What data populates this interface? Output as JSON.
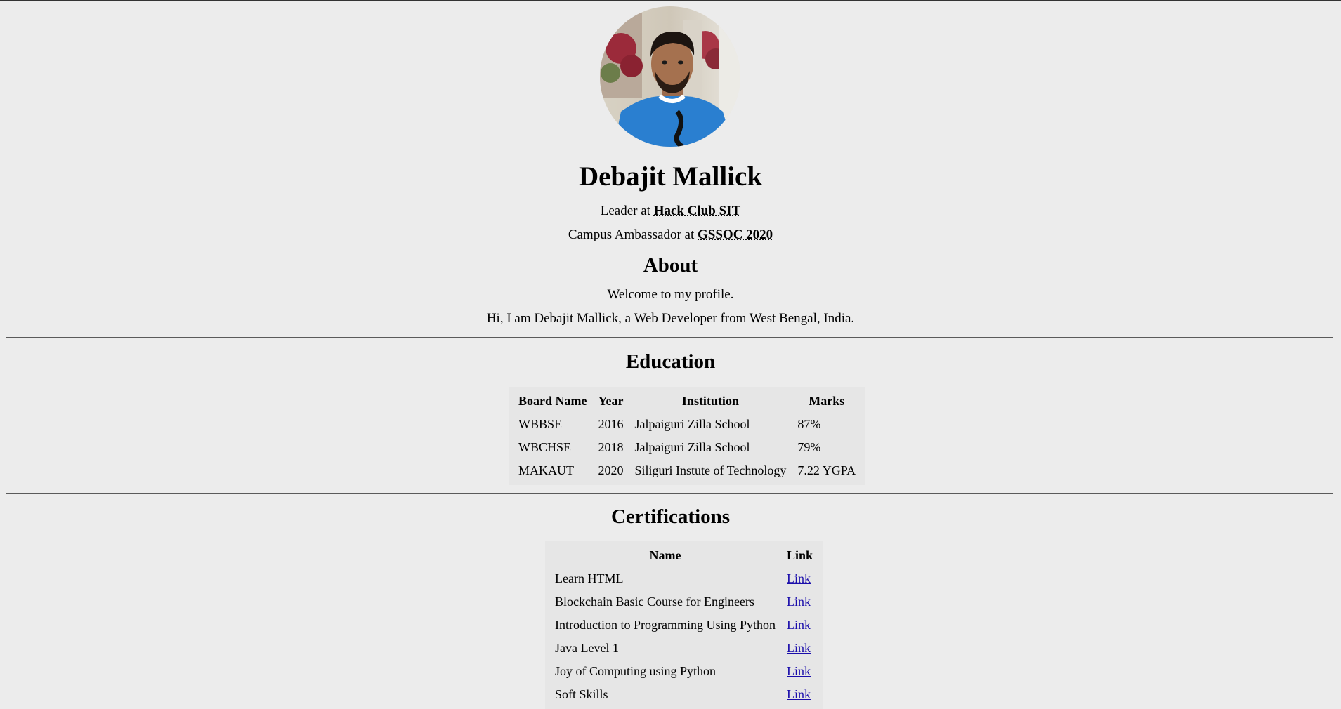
{
  "profile": {
    "name": "Debajit Mallick",
    "avatar_alt": "profile photo"
  },
  "roles": [
    {
      "prefix": "Leader at ",
      "org": "Hack Club SIT"
    },
    {
      "prefix": "Campus Ambassador at ",
      "org": "GSSOC 2020"
    }
  ],
  "about": {
    "title": "About",
    "line1": "Welcome to my profile.",
    "line2": "Hi, I am Debajit Mallick, a Web Developer from West Bengal, India."
  },
  "education": {
    "title": "Education",
    "headers": [
      "Board Name",
      "Year",
      "Institution",
      "Marks"
    ],
    "rows": [
      [
        "WBBSE",
        "2016",
        "Jalpaiguri Zilla School",
        "87%"
      ],
      [
        "WBCHSE",
        "2018",
        "Jalpaiguri Zilla School",
        "79%"
      ],
      [
        "MAKAUT",
        "2020",
        "Siliguri Instute of Technology",
        "7.22 YGPA"
      ]
    ]
  },
  "certifications": {
    "title": "Certifications",
    "headers": [
      "Name",
      "Link"
    ],
    "rows": [
      [
        "Learn HTML",
        "Link"
      ],
      [
        "Blockchain Basic Course for Engineers",
        "Link"
      ],
      [
        "Introduction to Programming Using Python",
        "Link"
      ],
      [
        "Java Level 1",
        "Link"
      ],
      [
        "Joy of Computing using Python",
        "Link"
      ],
      [
        "Soft Skills",
        "Link"
      ]
    ]
  },
  "colors": {
    "background": "#ececec",
    "table_bg": "#e6e6e6",
    "link": "#1a0dab",
    "rule": "#5a5a5a"
  }
}
